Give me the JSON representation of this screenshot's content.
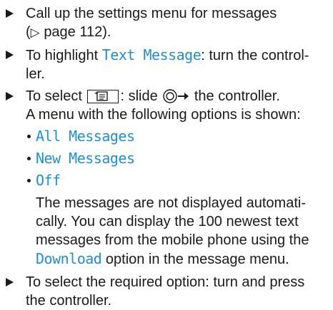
{
  "steps": {
    "s1": {
      "text_a": "Call up the settings menu for messages",
      "text_b": "(",
      "page_ref": "page 112",
      "text_c": ")."
    },
    "s2": {
      "text_a": "To highlight ",
      "highlight": "Text Message",
      "text_b": ": turn the control-",
      "text_c": "ler."
    },
    "s3": {
      "text_a": "To select ",
      "text_b": ": slide ",
      "text_c": " the controller.",
      "line2": "A menu with the following options is shown:"
    },
    "options": [
      "All Messages",
      "New Messages",
      "Off"
    ],
    "note": {
      "line1": "The messages are not displayed automati-",
      "line2": "cally. You can display the 100 newest text",
      "line3": "messages from the mobile phone using the",
      "download": "Download",
      "line4_rest": " option in the message menu."
    },
    "s4": {
      "line1": "To select the required option: turn and press",
      "line2": "the controller."
    }
  },
  "colors": {
    "accent": "#1f8fd2",
    "text": "#1a1a1a"
  },
  "icons": {
    "bullet": "triangle-right-icon",
    "page_ref": "triangle-outline-right-icon",
    "key": "phone-message-key-icon",
    "controller": "controller-slide-right-icon"
  }
}
